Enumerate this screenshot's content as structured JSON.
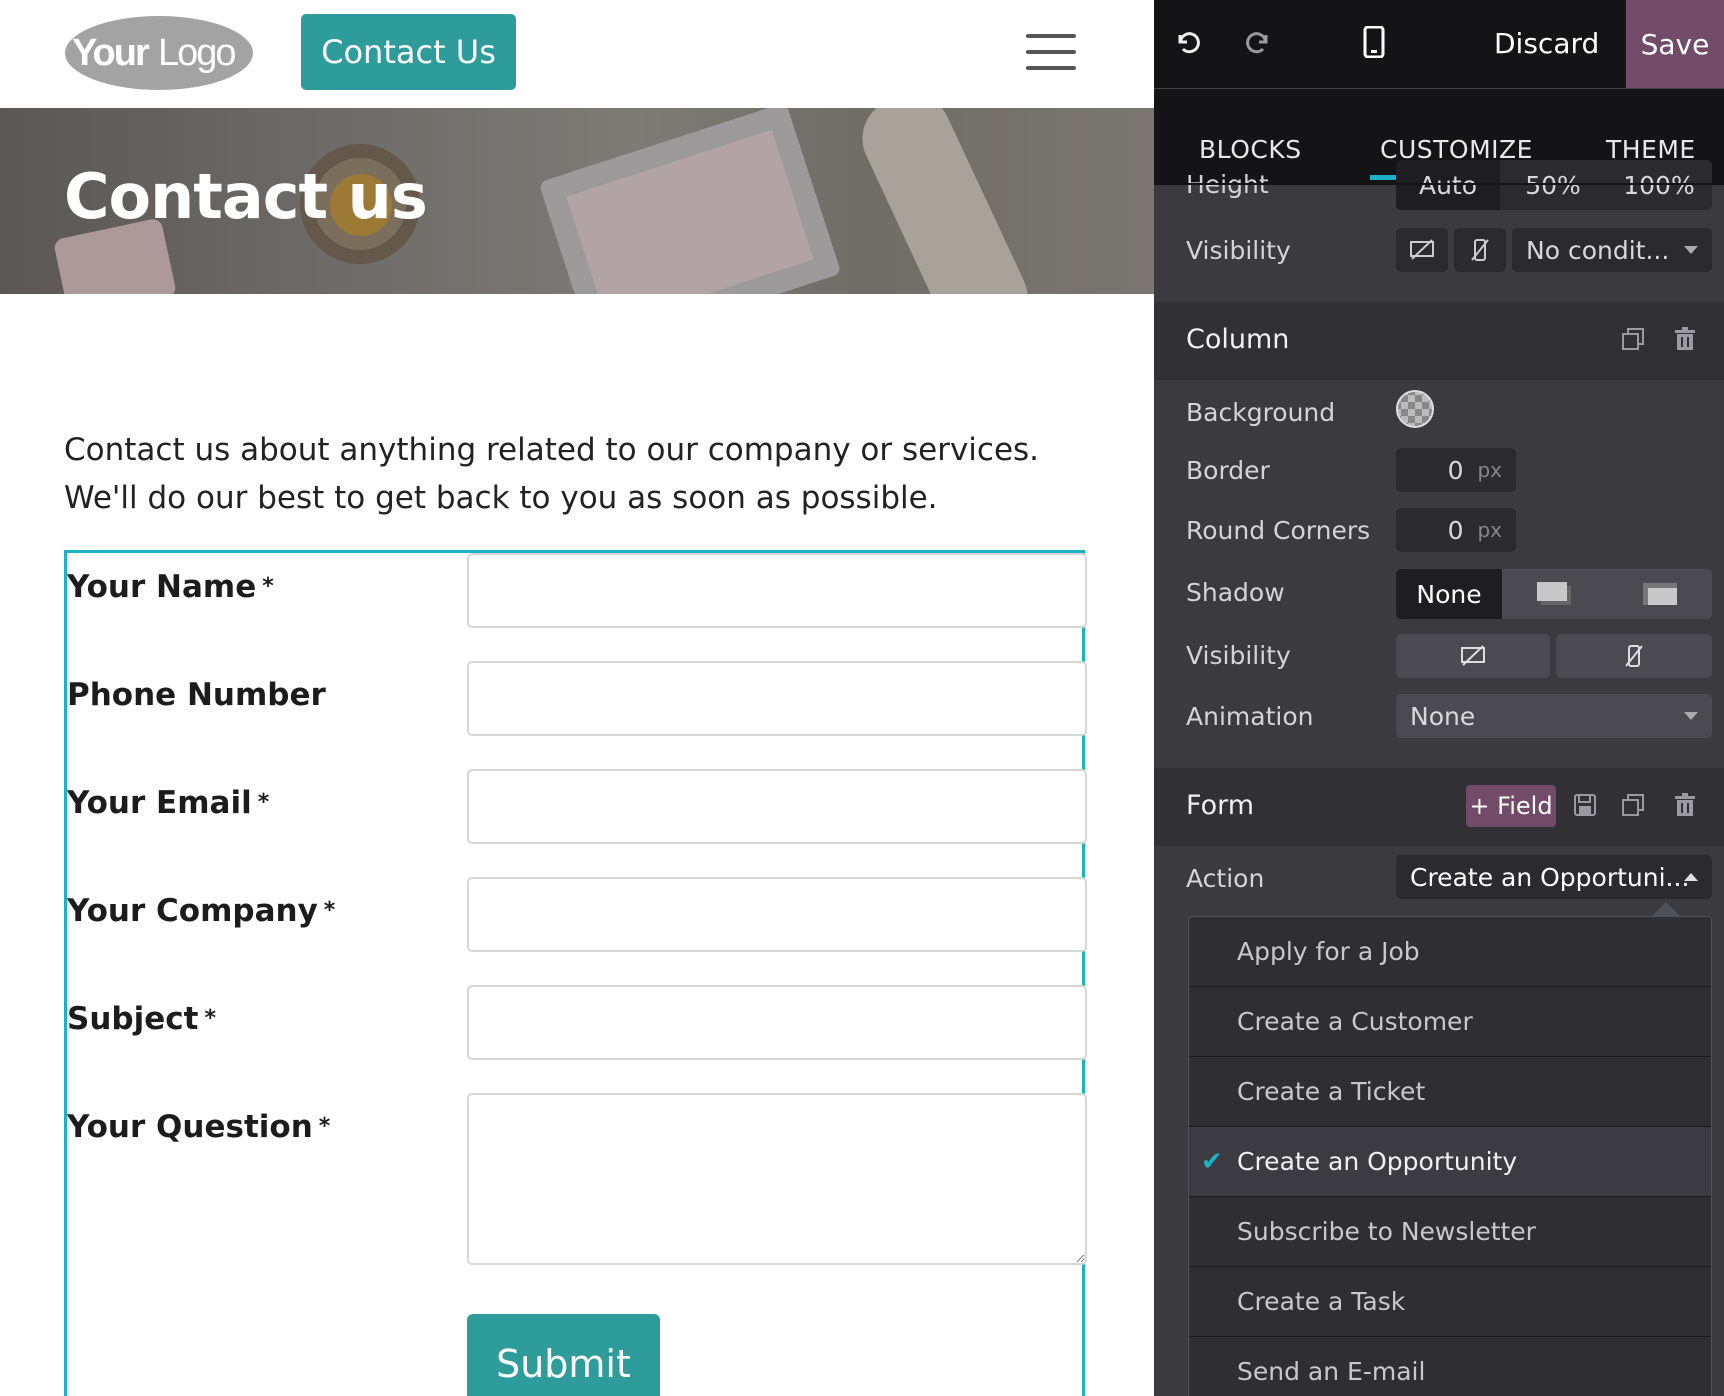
{
  "site": {
    "logo_text": "YourLogo",
    "contact_button": "Contact Us",
    "banner_title": "Contact us",
    "intro_line1": "Contact us about anything related to our company or services.",
    "intro_line2": "We'll do our best to get back to you as soon as possible.",
    "form": {
      "fields": [
        {
          "label": "Your Name",
          "required": "*"
        },
        {
          "label": "Phone Number",
          "required": ""
        },
        {
          "label": "Your Email",
          "required": "*"
        },
        {
          "label": "Your Company",
          "required": "*"
        },
        {
          "label": "Subject",
          "required": "*"
        },
        {
          "label": "Your Question",
          "required": "*"
        }
      ],
      "submit_label": "Submit"
    }
  },
  "editor": {
    "topbar": {
      "undo_icon": "undo-icon",
      "redo_icon": "redo-icon",
      "mobile_icon": "mobile-preview-icon",
      "discard_label": "Discard",
      "save_label": "Save"
    },
    "tabs": [
      "BLOCKS",
      "CUSTOMIZE",
      "THEME"
    ],
    "active_tab": "CUSTOMIZE",
    "top_section": {
      "height_label": "Height",
      "height_options": [
        "Auto",
        "50%",
        "100%"
      ],
      "visibility_label": "Visibility",
      "visibility_condition": "No condit..."
    },
    "column": {
      "title": "Column",
      "background_label": "Background",
      "border_label": "Border",
      "border_value": "0",
      "border_unit": "px",
      "round_corners_label": "Round Corners",
      "round_corners_value": "0",
      "round_corners_unit": "px",
      "shadow_label": "Shadow",
      "shadow_none": "None",
      "visibility_label": "Visibility",
      "animation_label": "Animation",
      "animation_value": "None"
    },
    "form_section": {
      "title": "Form",
      "add_field_label": "+ Field",
      "action_label": "Action",
      "action_value": "Create an Opportuni...",
      "options": [
        "Apply for a Job",
        "Create a Customer",
        "Create a Ticket",
        "Create an Opportunity",
        "Subscribe to Newsletter",
        "Create a Task",
        "Send an E-mail"
      ],
      "selected_option": "Create an Opportunity"
    }
  },
  "colors": {
    "brand_teal": "#2f9c9c",
    "selection_cyan": "#1cb1c4",
    "save_purple": "#714b67",
    "panel_bg": "#3a3a3f"
  }
}
